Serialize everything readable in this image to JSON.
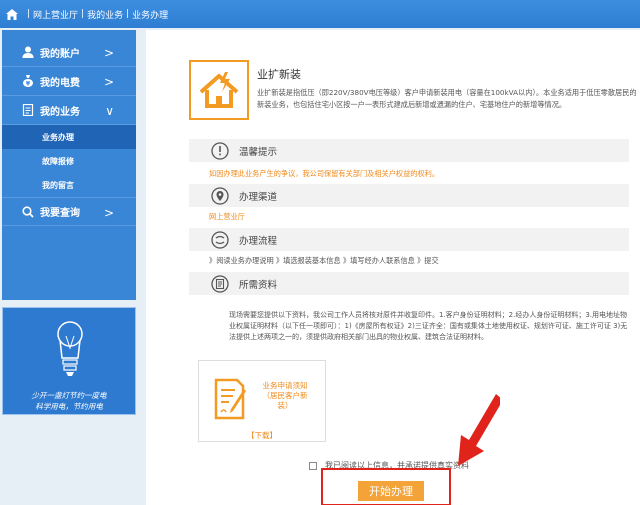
{
  "breadcrumb": [
    "网上营业厅",
    "我的业务",
    "业务办理"
  ],
  "sidebar": {
    "items": [
      {
        "label": "我的账户",
        "icon": "user-icon",
        "chevron": ">"
      },
      {
        "label": "我的电费",
        "icon": "money-icon",
        "chevron": ">"
      },
      {
        "label": "我的业务",
        "icon": "document-icon",
        "chevron": "∨"
      }
    ],
    "sub_items": [
      "业务办理",
      "故障报修",
      "我的留言"
    ],
    "query": {
      "label": "我要查询",
      "icon": "search-icon",
      "chevron": ">"
    }
  },
  "promo": {
    "line1": "少开一盏灯节约一度电",
    "line2": "科学用电，节约用电"
  },
  "service": {
    "title": "业扩新装",
    "description": "业扩新装是指低压（即220V/380V电压等级）客户申请新装用电（容量在100kVA以内）。本业务适用于低压零散居民的新装业务，也包括住宅小区按一户一表形式建成后新增或遗漏的住户、宅基地住户的新增等情况。"
  },
  "sections": {
    "tips": {
      "title": "温馨提示",
      "text": "如因办理此业务产生的争议，我公司保留有关部门及相关户权益的权利。"
    },
    "channel": {
      "title": "办理渠道",
      "text": "网上营业厅"
    },
    "flow": {
      "title": "办理流程",
      "text": "》阅读业务办理说明 》填选报装基本信息 》填写经办人联系信息 》提交"
    },
    "materials": {
      "title": "所需资料",
      "text": "现场需要您提供以下资料，我公司工作人员将核对原件并收复印件。1.客户身份证明材料；2.经办人身份证明材料；3.用电地址物业权属证明材料（以下任一项即可）：1)《房屋所有权证》2)三证齐全：国有或集体土地使用权证、规划许可证、施工许可证 3)无法提供上述两项之一的，须提供政府相关部门出具的物业权属、建筑合法证明材料。"
    }
  },
  "document": {
    "name": "业务申请须知（居民客户新装）",
    "download": "【下载】"
  },
  "agreement": "我已阅读以上信息，并承诺提供真实资料",
  "start_button": "开始办理",
  "colors": {
    "accent": "#f4a338",
    "sidebar": "#3a86d6",
    "highlight": "#e0231b"
  }
}
